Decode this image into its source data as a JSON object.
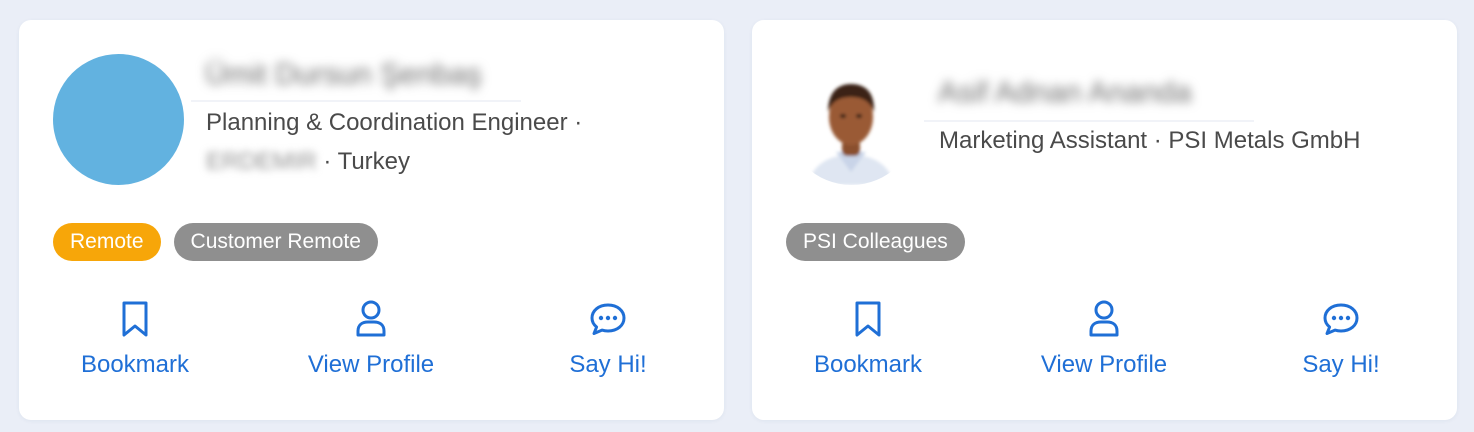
{
  "cards": [
    {
      "name": "Ümit Dursun Şenbaş",
      "subtitle_line1": "Planning & Coordination Engineer ·",
      "company": "ERDEMIR",
      "subtitle_line2_rest": " · Turkey",
      "tags": [
        "Remote",
        "Customer Remote"
      ],
      "actions": {
        "bookmark": "Bookmark",
        "view_profile": "View Profile",
        "say_hi": "Say Hi!"
      }
    },
    {
      "name": "Asif Adnan Ananda",
      "subtitle": "Marketing Assistant · PSI Metals GmbH",
      "tags": [
        "PSI Colleagues"
      ],
      "actions": {
        "bookmark": "Bookmark",
        "view_profile": "View Profile",
        "say_hi": "Say Hi!"
      }
    }
  ],
  "colors": {
    "background": "#eaeef7",
    "card": "#ffffff",
    "accent": "#1f6fd6",
    "avatar_placeholder": "#62b2e0",
    "tag_remote": "#f7a609",
    "tag_gray": "#8f8f8f"
  },
  "icons": {
    "bookmark": "bookmark-icon",
    "view_profile": "user-icon",
    "say_hi": "chat-bubble-icon"
  }
}
